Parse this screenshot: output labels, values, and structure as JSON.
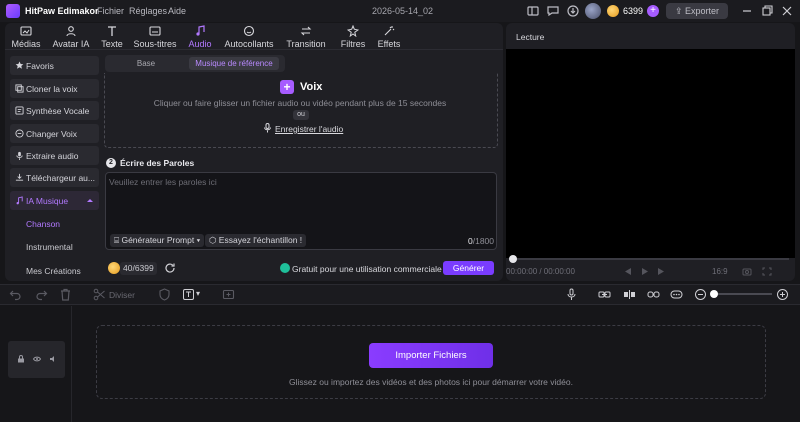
{
  "app": {
    "title": "HitPaw Edimakor",
    "menu": [
      "Fichier",
      "Réglages",
      "Aide"
    ],
    "project_name": "2026-05-14_02",
    "credits": "6399",
    "export_label": "Exporter"
  },
  "tabs": [
    {
      "label": "Médias",
      "icon": "media-icon"
    },
    {
      "label": "Avatar IA",
      "icon": "avatar-icon"
    },
    {
      "label": "Texte",
      "icon": "text-icon"
    },
    {
      "label": "Sous-titres",
      "icon": "subtitles-icon"
    },
    {
      "label": "Audio",
      "icon": "music-note-icon",
      "active": true
    },
    {
      "label": "Autocollants",
      "icon": "sticker-icon"
    },
    {
      "label": "Transition",
      "icon": "transition-icon"
    },
    {
      "label": "Filtres",
      "icon": "filter-icon"
    },
    {
      "label": "Effets",
      "icon": "effects-icon"
    }
  ],
  "sidebar": {
    "items": [
      {
        "label": "Favoris",
        "icon": "star-icon"
      },
      {
        "label": "Cloner la voix",
        "icon": "clone-icon"
      },
      {
        "label": "Synthèse Vocale",
        "icon": "speech-icon"
      },
      {
        "label": "Changer Voix",
        "icon": "voice-changer-icon"
      },
      {
        "label": "Extraire audio",
        "icon": "mic-icon"
      },
      {
        "label": "Téléchargeur au...",
        "icon": "download-icon"
      },
      {
        "label": "IA Musique",
        "icon": "ai-music-icon",
        "expanded": true
      }
    ],
    "subitems": [
      {
        "label": "Chanson",
        "active": true
      },
      {
        "label": "Instrumental"
      },
      {
        "label": "Mes Créations"
      }
    ]
  },
  "segment": {
    "options": [
      "Base",
      "Musique de référence"
    ],
    "active": "Musique de référence"
  },
  "dropzone": {
    "title": "Voix",
    "hint": "Cliquer ou faire glisser un fichier audio ou vidéo pendant plus de 15 secondes",
    "or": "ou",
    "record_label": "Enregistrer l'audio"
  },
  "lyrics": {
    "step": "2",
    "title": "Écrire des Paroles",
    "placeholder": "Veuillez entrer les paroles ici",
    "prompt_generator": "Générateur Prompt",
    "try_sample": "Essayez l'échantillon !",
    "count": "0",
    "max": "/1800"
  },
  "footer": {
    "credits": "40/6399",
    "free_note": "Gratuit pour une utilisation commerciale",
    "generate_label": "Générer"
  },
  "preview": {
    "title": "Lecture",
    "time": "00:00:00 / 00:00:00",
    "zoom": "16:9"
  },
  "timeline_toolbar": {
    "divide_label": "Diviser"
  },
  "timeline": {
    "import_label": "Importer Fichiers",
    "import_hint": "Glissez ou importez des vidéos et des photos ici pour démarrer votre vidéo."
  },
  "colors": {
    "accent": "#a65cff",
    "button": "#7a3cff",
    "free_badge": "#1fbf9a"
  }
}
